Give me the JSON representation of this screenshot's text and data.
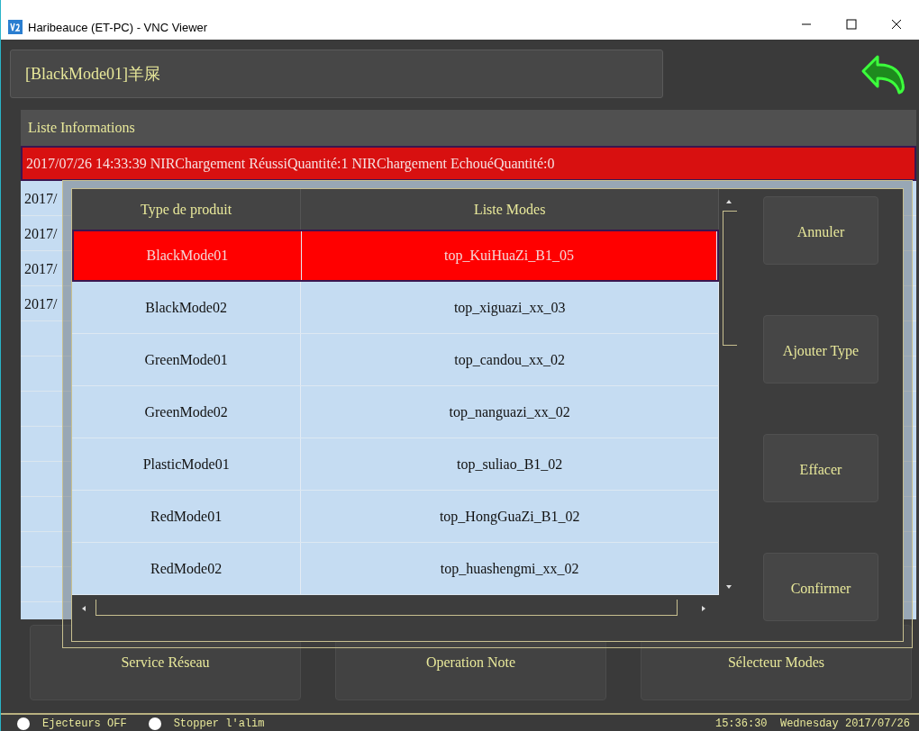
{
  "window": {
    "title": "Haribeauce (ET-PC) - VNC Viewer"
  },
  "header": {
    "title": "[BlackMode01]羊屎"
  },
  "info_panel": {
    "title": "Liste Informations",
    "rows": [
      {
        "text": "2017/07/26 14:33:39   NIRChargement RéussiQuantité:1   NIRChargement EchouéQuantité:0",
        "selected": true
      },
      {
        "text": "2017/",
        "selected": false
      },
      {
        "text": "2017/",
        "selected": false
      },
      {
        "text": "2017/",
        "selected": false
      },
      {
        "text": "2017/",
        "selected": false
      }
    ]
  },
  "bottom_buttons": [
    "Service Réseau",
    "Operation Note",
    "Sélecteur Modes"
  ],
  "status_bar": {
    "indicators": [
      "Ejecteurs OFF",
      "Stopper l'alim"
    ],
    "datetime": "15:36:30  Wednesday 2017/07/26"
  },
  "dialog": {
    "columns": [
      "Type de produit",
      "Liste Modes"
    ],
    "rows": [
      {
        "type": "BlackMode01",
        "mode": "top_KuiHuaZi_B1_05",
        "selected": true
      },
      {
        "type": "BlackMode02",
        "mode": "top_xiguazi_xx_03",
        "selected": false
      },
      {
        "type": "GreenMode01",
        "mode": "top_candou_xx_02",
        "selected": false
      },
      {
        "type": "GreenMode02",
        "mode": "top_nanguazi_xx_02",
        "selected": false
      },
      {
        "type": "PlasticMode01",
        "mode": "top_suliao_B1_02",
        "selected": false
      },
      {
        "type": "RedMode01",
        "mode": "top_HongGuaZi_B1_02",
        "selected": false
      },
      {
        "type": "RedMode02",
        "mode": "top_huashengmi_xx_02",
        "selected": false
      }
    ],
    "buttons": [
      "Annuler",
      "Ajouter Type",
      "Effacer",
      "Confirmer"
    ]
  }
}
